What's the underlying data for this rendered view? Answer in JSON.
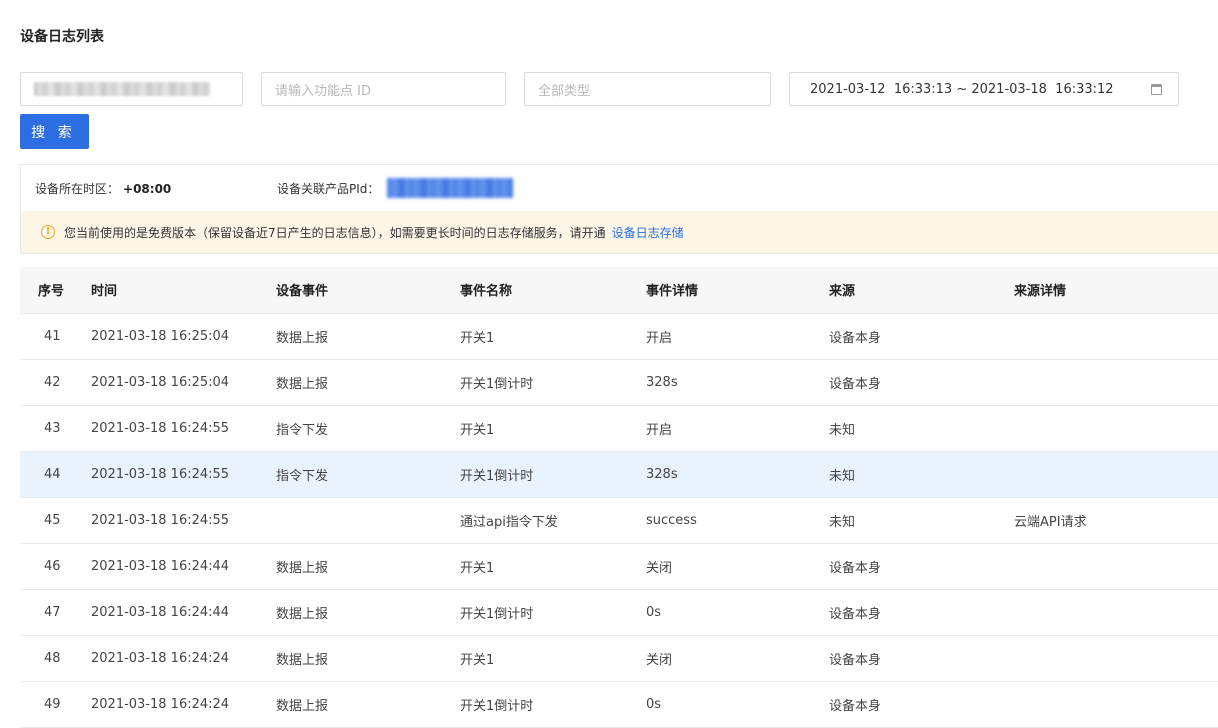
{
  "page": {
    "title": "设备日志列表"
  },
  "filters": {
    "function_id_placeholder": "请输入功能点 ID",
    "type_value": "全部类型",
    "date_range": "2021-03-12  16:33:13 ~ 2021-03-18  16:33:12",
    "search_label": "搜 索"
  },
  "info": {
    "timezone_label": "设备所在时区：",
    "timezone_value": "+08:00",
    "product_pid_label": "设备关联产品PId：",
    "notice_text": "您当前使用的是免费版本（保留设备近7日产生的日志信息），如需要更长时间的日志存储服务，请开通",
    "notice_link": "设备日志存储"
  },
  "colors": {
    "primary": "#2d6fe3",
    "notice_bg": "#fdf6e6",
    "warning": "#f5a623",
    "row_highlight": "#e9f3fd"
  },
  "table": {
    "headers": {
      "index": "序号",
      "time": "时间",
      "device_event": "设备事件",
      "event_name": "事件名称",
      "event_detail": "事件详情",
      "source": "来源",
      "source_detail": "来源详情"
    },
    "rows": [
      {
        "index": "41",
        "time": "2021-03-18 16:25:04",
        "event": "数据上报",
        "name": "开关1",
        "detail": "开启",
        "source": "设备本身",
        "source_detail": ""
      },
      {
        "index": "42",
        "time": "2021-03-18 16:25:04",
        "event": "数据上报",
        "name": "开关1倒计时",
        "detail": "328s",
        "source": "设备本身",
        "source_detail": ""
      },
      {
        "index": "43",
        "time": "2021-03-18 16:24:55",
        "event": "指令下发",
        "name": "开关1",
        "detail": "开启",
        "source": "未知",
        "source_detail": ""
      },
      {
        "index": "44",
        "time": "2021-03-18 16:24:55",
        "event": "指令下发",
        "name": "开关1倒计时",
        "detail": "328s",
        "source": "未知",
        "source_detail": ""
      },
      {
        "index": "45",
        "time": "2021-03-18 16:24:55",
        "event": "",
        "name": "通过api指令下发",
        "detail": "success",
        "source": "未知",
        "source_detail": "云端API请求"
      },
      {
        "index": "46",
        "time": "2021-03-18 16:24:44",
        "event": "数据上报",
        "name": "开关1",
        "detail": "关闭",
        "source": "设备本身",
        "source_detail": ""
      },
      {
        "index": "47",
        "time": "2021-03-18 16:24:44",
        "event": "数据上报",
        "name": "开关1倒计时",
        "detail": "0s",
        "source": "设备本身",
        "source_detail": ""
      },
      {
        "index": "48",
        "time": "2021-03-18 16:24:24",
        "event": "数据上报",
        "name": "开关1",
        "detail": "关闭",
        "source": "设备本身",
        "source_detail": ""
      },
      {
        "index": "49",
        "time": "2021-03-18 16:24:24",
        "event": "数据上报",
        "name": "开关1倒计时",
        "detail": "0s",
        "source": "设备本身",
        "source_detail": ""
      }
    ]
  }
}
